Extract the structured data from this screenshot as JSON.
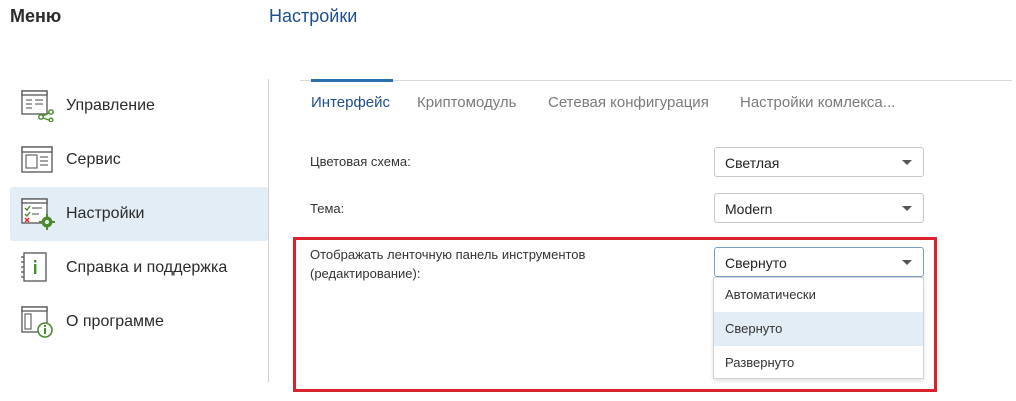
{
  "menu": {
    "title": "Меню"
  },
  "page": {
    "title": "Настройки"
  },
  "sidebar": {
    "items": [
      {
        "label": "Управление",
        "icon": "management-icon",
        "active": false
      },
      {
        "label": "Сервис",
        "icon": "service-icon",
        "active": false
      },
      {
        "label": "Настройки",
        "icon": "settings-icon",
        "active": true
      },
      {
        "label": "Справка и поддержка",
        "icon": "help-icon",
        "active": false
      },
      {
        "label": "О программе",
        "icon": "about-icon",
        "active": false
      }
    ]
  },
  "tabs": [
    {
      "label": "Интерфейс",
      "active": true
    },
    {
      "label": "Криптомодуль",
      "active": false
    },
    {
      "label": "Сетевая конфигурация",
      "active": false
    },
    {
      "label": "Настройки комлекса...",
      "active": false
    }
  ],
  "settings": {
    "color_scheme": {
      "label": "Цветовая схема:",
      "value": "Светлая"
    },
    "theme": {
      "label": "Тема:",
      "value": "Modern"
    },
    "ribbon": {
      "label_line1": "Отображать ленточную панель инструментов",
      "label_line2": "(редактирование):",
      "value": "Свернуто",
      "options": [
        "Автоматически",
        "Свернуто",
        "Развернуто"
      ],
      "selected_option": "Свернуто"
    }
  },
  "colors": {
    "accent": "#2c6fb0",
    "title_blue": "#1f4e8c",
    "active_bg": "#e3edf6",
    "highlight_red": "#d9232d",
    "icon_green": "#4b8b2b"
  }
}
